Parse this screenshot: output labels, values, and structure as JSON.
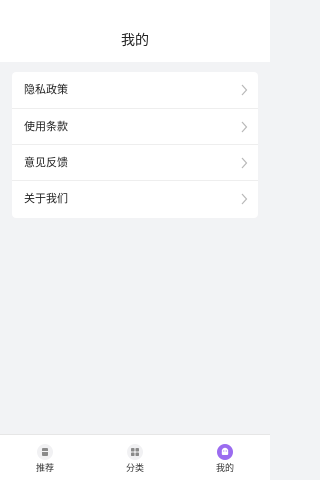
{
  "header": {
    "title": "我的"
  },
  "menu": {
    "items": [
      {
        "label": "隐私政策",
        "icon": "chevron-right-icon"
      },
      {
        "label": "使用条款",
        "icon": "chevron-right-icon"
      },
      {
        "label": "意见反馈",
        "icon": "chevron-right-icon"
      },
      {
        "label": "关于我们",
        "icon": "chevron-right-icon"
      }
    ]
  },
  "tabbar": {
    "active": "我的",
    "tabs": [
      {
        "label": "推荐",
        "icon": "book-icon"
      },
      {
        "label": "分类",
        "icon": "grid-icon"
      },
      {
        "label": "我的",
        "icon": "profile-icon"
      }
    ]
  },
  "colors": {
    "accent": "#9b6cf0",
    "background": "#f2f3f5",
    "surface": "#ffffff"
  }
}
